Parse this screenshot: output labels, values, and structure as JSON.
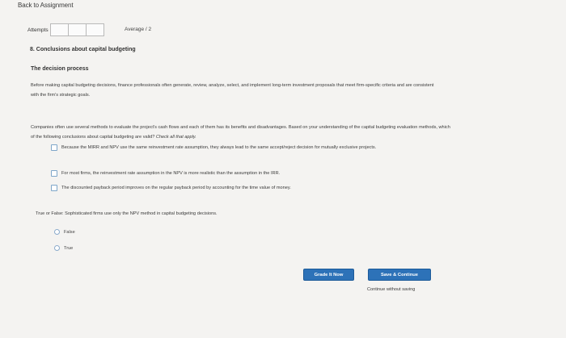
{
  "nav": {
    "back_label": "Back to Assignment"
  },
  "attempts": {
    "label": "Attempts",
    "average_label": "Average / 2"
  },
  "question": {
    "title": "8. Conclusions about capital budgeting",
    "section_heading": "The decision process",
    "intro_text": "Before making capital budgeting decisions, finance professionals often generate, review, analyze, select, and implement long-term investment proposals that meet firm-specific criteria and are consistent with the firm's strategic goals.",
    "prompt_text": "Companies often use several methods to evaluate the project's cash flows and each of them has its benefits and disadvantages. Based on your understanding of the capital budgeting evaluation methods, which of the following conclusions about capital budgeting are valid?",
    "prompt_instruction": "Check all that apply.",
    "options": [
      {
        "label": "Because the MIRR and NPV use the same reinvestment rate assumption, they always lead to the same accept/reject decision for mutually exclusive projects."
      },
      {
        "label": "For most firms, the reinvestment rate assumption in the NPV is more realistic than the assumption in the IRR."
      },
      {
        "label": "The discounted payback period improves on the regular payback period by accounting for the time value of money."
      }
    ]
  },
  "true_false": {
    "question": "True or False: Sophisticated firms use only the NPV method in capital budgeting decisions.",
    "options": [
      {
        "label": "False"
      },
      {
        "label": "True"
      }
    ]
  },
  "actions": {
    "grade_label": "Grade It Now",
    "save_label": "Save & Continue",
    "continue_label": "Continue without saving"
  },
  "colors": {
    "button_blue": "#2d72b8",
    "background": "#f4f3f1"
  }
}
